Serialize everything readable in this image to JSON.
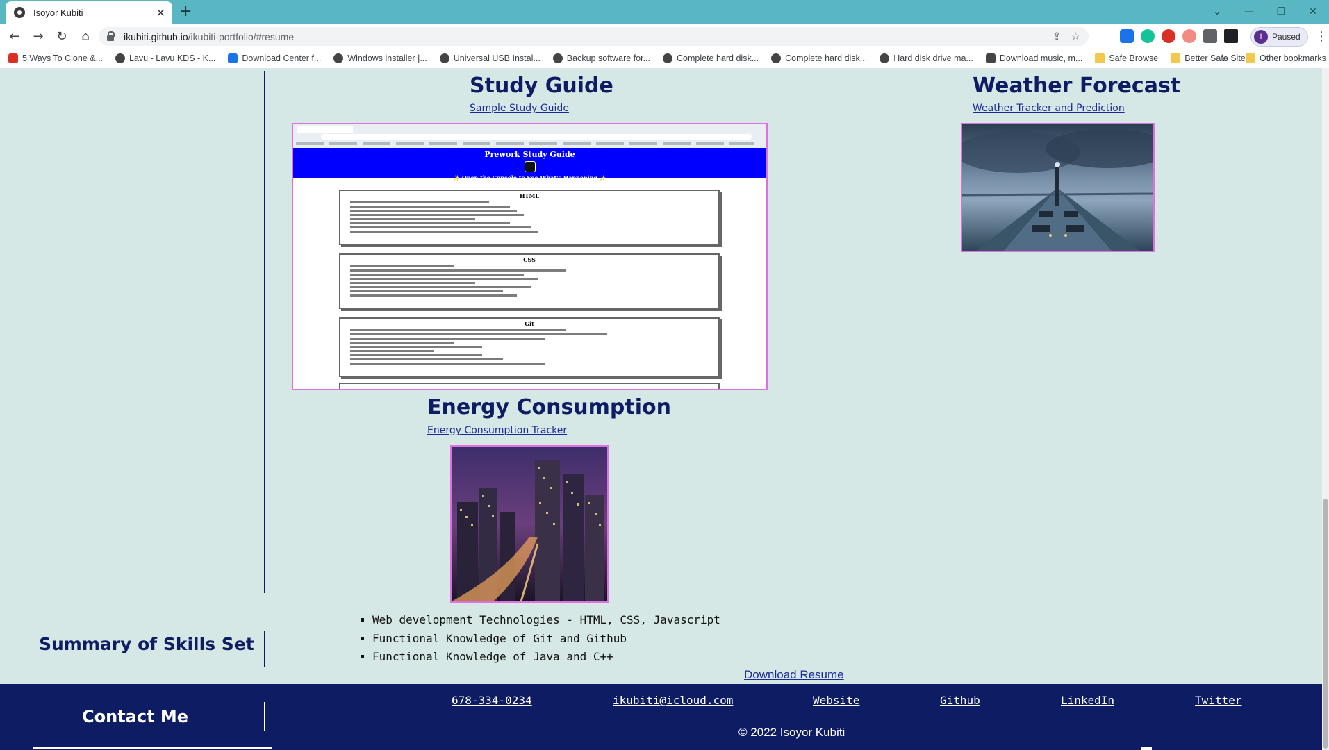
{
  "browser": {
    "tab_title": "Isoyor Kubiti",
    "url_host": "ikubiti.github.io",
    "url_path": "/ikubiti-portfolio/#resume",
    "profile_label": "Paused",
    "profile_initial": "I",
    "bookmarks": [
      "5 Ways To Clone &...",
      "Lavu - Lavu KDS - K...",
      "Download Center f...",
      "Windows installer |...",
      "Universal USB Instal...",
      "Backup software for...",
      "Complete hard disk...",
      "Complete hard disk...",
      "Hard disk drive ma...",
      "Download music, m...",
      "Safe Browse",
      "Better Safe Site"
    ],
    "other_bookmarks": "Other bookmarks",
    "more": "»"
  },
  "projects": {
    "study_guide": {
      "title": "Study Guide",
      "link": "Sample Study Guide",
      "preview": {
        "hero_title": "Prework Study Guide",
        "hero_subtitle": "✨ Open the Console to See What's Happening ✨",
        "cards": [
          "HTML",
          "CSS",
          "Git"
        ]
      }
    },
    "weather": {
      "title": "Weather Forecast",
      "link": "Weather Tracker and Prediction"
    },
    "energy": {
      "title": "Energy Consumption",
      "link": "Energy Consumption Tracker"
    }
  },
  "skills": {
    "title": "Summary of Skills Set",
    "items": [
      "Web development Technologies - HTML, CSS, Javascript",
      "Functional Knowledge of Git and Github",
      "Functional Knowledge of Java and C++"
    ],
    "download": "Download Resume"
  },
  "footer": {
    "title": "Contact Me",
    "links": [
      "678-334-0234",
      "ikubiti@icloud.com",
      "Website",
      "Github",
      "LinkedIn",
      "Twitter"
    ],
    "copyright": "© 2022 Isoyor Kubiti"
  },
  "colors": {
    "page_bg": "#d6e8e6",
    "navy": "#0e1d63",
    "tab_bar": "#59b7c3",
    "image_border": "#e070e0"
  }
}
